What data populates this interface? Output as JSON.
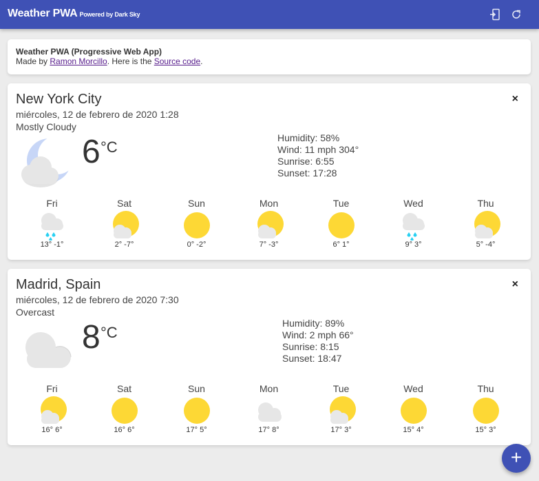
{
  "header": {
    "title": "Weather PWA",
    "powered": "Powered by Dark Sky",
    "install_icon": "install-icon",
    "refresh_icon": "refresh-icon",
    "bg_color": "#3f51b5"
  },
  "about": {
    "title": "Weather PWA (Progressive Web App)",
    "made_by": "Made by ",
    "author": "Ramon Morcillo",
    "here_is": ". Here is the ",
    "source": "Source code",
    "end": "."
  },
  "locations": [
    {
      "city": "New York City",
      "date": "miércoles, 12 de febrero de 2020 1:28",
      "description": "Mostly Cloudy",
      "icon": "partly-cloudy-night",
      "temperature": "6",
      "unit": "°C",
      "humidity": "Humidity: 58%",
      "wind": "Wind: 11 mph 304°",
      "sunrise": "Sunrise: 6:55",
      "sunset": "Sunset: 17:28",
      "close": "×",
      "forecast": [
        {
          "day": "Fri",
          "icon": "rain",
          "temps": "13° -1°"
        },
        {
          "day": "Sat",
          "icon": "partly-cloudy-day",
          "temps": "2° -7°"
        },
        {
          "day": "Sun",
          "icon": "clear-day",
          "temps": "0° -2°"
        },
        {
          "day": "Mon",
          "icon": "partly-cloudy-day",
          "temps": "7° -3°"
        },
        {
          "day": "Tue",
          "icon": "clear-day",
          "temps": "6° 1°"
        },
        {
          "day": "Wed",
          "icon": "rain",
          "temps": "9° 3°"
        },
        {
          "day": "Thu",
          "icon": "partly-cloudy-day",
          "temps": "5° -4°"
        }
      ]
    },
    {
      "city": "Madrid, Spain",
      "date": "miércoles, 12 de febrero de 2020 7:30",
      "description": "Overcast",
      "icon": "cloudy",
      "temperature": "8",
      "unit": "°C",
      "humidity": "Humidity: 89%",
      "wind": "Wind: 2 mph 66°",
      "sunrise": "Sunrise: 8:15",
      "sunset": "Sunset: 18:47",
      "close": "×",
      "forecast": [
        {
          "day": "Fri",
          "icon": "partly-cloudy-day",
          "temps": "16° 6°"
        },
        {
          "day": "Sat",
          "icon": "clear-day",
          "temps": "16° 6°"
        },
        {
          "day": "Sun",
          "icon": "clear-day",
          "temps": "17° 5°"
        },
        {
          "day": "Mon",
          "icon": "cloudy",
          "temps": "17° 8°"
        },
        {
          "day": "Tue",
          "icon": "partly-cloudy-day",
          "temps": "17° 3°"
        },
        {
          "day": "Wed",
          "icon": "clear-day",
          "temps": "15° 4°"
        },
        {
          "day": "Thu",
          "icon": "clear-day",
          "temps": "15° 3°"
        }
      ]
    }
  ],
  "fab": {
    "label": "+",
    "icon": "add-icon"
  }
}
